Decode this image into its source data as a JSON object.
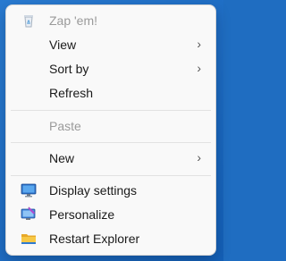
{
  "menu": {
    "zap": {
      "label": "Zap 'em!",
      "icon": "recycle-bin-icon"
    },
    "view": {
      "label": "View"
    },
    "sort": {
      "label": "Sort by"
    },
    "refresh": {
      "label": "Refresh"
    },
    "paste": {
      "label": "Paste"
    },
    "new": {
      "label": "New"
    },
    "display": {
      "label": "Display settings",
      "icon": "monitor-icon"
    },
    "personalize": {
      "label": "Personalize",
      "icon": "personalize-icon"
    },
    "restart": {
      "label": "Restart Explorer",
      "icon": "folder-icon"
    },
    "submenu_chevron": "›"
  },
  "colors": {
    "menu_background": "#f9f9f9",
    "text": "#1a1a1a",
    "disabled_text": "#9a9a9a",
    "desktop_background": "#1f6dc1"
  }
}
